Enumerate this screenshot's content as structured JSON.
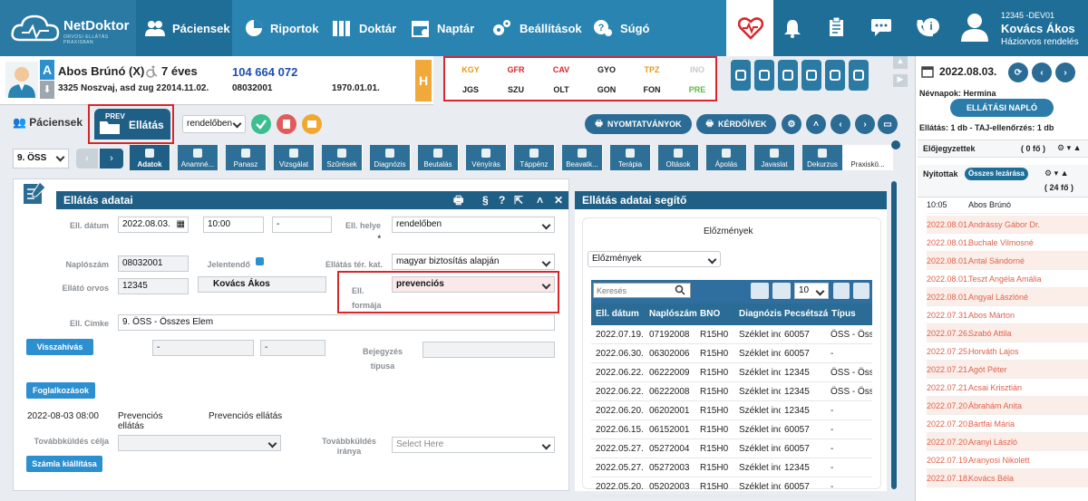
{
  "app": {
    "name": "NetDoktor",
    "tagline": "ORVOSI ELLÁTÁS PRAXISBAN"
  },
  "nav": {
    "items": [
      {
        "label": "Páciensek",
        "icon": "users-icon"
      },
      {
        "label": "Riportok",
        "icon": "pie-chart-icon"
      },
      {
        "label": "Doktár",
        "icon": "books-icon"
      },
      {
        "label": "Naptár",
        "icon": "calendar-icon"
      },
      {
        "label": "Beállítások",
        "icon": "gears-icon"
      },
      {
        "label": "Súgó",
        "icon": "help-icon"
      }
    ]
  },
  "user": {
    "id": "12345 -DEV01",
    "name": "Kovács Ákos",
    "role": "Háziorvos rendelés"
  },
  "patient": {
    "badge": "A",
    "name": "Abos Brúnó (X)",
    "age": "7 éves",
    "taj": "104 664 072",
    "address": "3325 Noszvaj, asd zug 2",
    "date1": "2014.11.02.",
    "code": "08032001",
    "birth": "1970.01.01.",
    "h_badge": "H"
  },
  "codes": [
    {
      "label": "KGY",
      "color": "#e39a17"
    },
    {
      "label": "GFR",
      "color": "#d9262c"
    },
    {
      "label": "CAV",
      "color": "#d9262c"
    },
    {
      "label": "GYO",
      "color": "#222222"
    },
    {
      "label": "TPZ",
      "color": "#e39a17"
    },
    {
      "label": "INO",
      "color": "#c9c9c9"
    },
    {
      "label": "JGS",
      "color": "#222222"
    },
    {
      "label": "SZU",
      "color": "#222222"
    },
    {
      "label": "OLT",
      "color": "#222222"
    },
    {
      "label": "GON",
      "color": "#222222"
    },
    {
      "label": "FON",
      "color": "#222222"
    },
    {
      "label": "PRE",
      "color": "#5fb83d"
    }
  ],
  "right": {
    "date": "2022.08.03.",
    "nevnapok": "Névnapok: Hermina",
    "naplo_btn": "ELLÁTÁSI NAPLÓ",
    "ellatas_info": "Ellátás: 1 db - TAJ-ellenőrzés: 1 db",
    "elojegyzettek": "Előjegyzettek",
    "elo_count": "( 0 fő )",
    "nyitottak": "Nyitottak",
    "osszes_lezarasa": "Összes lezárása",
    "ny_count": "( 24 fő )",
    "first": {
      "time": "10:05",
      "name": "Abos Brúnó"
    },
    "rows": [
      {
        "date": "2022.08.01.",
        "name": "Andrássy Gábor Dr."
      },
      {
        "date": "2022.08.01.",
        "name": "Buchale Vilmosné"
      },
      {
        "date": "2022.08.01.",
        "name": "Antal Sándorné"
      },
      {
        "date": "2022.08.01.",
        "name": "Teszt Angéla Amália"
      },
      {
        "date": "2022.08.01.",
        "name": "Angyal Lászlóné"
      },
      {
        "date": "2022.07.31.",
        "name": "Abos Márton"
      },
      {
        "date": "2022.07.26.",
        "name": "Szabó Attila"
      },
      {
        "date": "2022.07.25.",
        "name": "Horváth Lajos"
      },
      {
        "date": "2022.07.21.",
        "name": "Agót Péter"
      },
      {
        "date": "2022.07.21.",
        "name": "Acsai Krisztián"
      },
      {
        "date": "2022.07.20.",
        "name": "Ábrahám Anita"
      },
      {
        "date": "2022.07.20.",
        "name": "Bártfai Mária"
      },
      {
        "date": "2022.07.20.",
        "name": "Aranyi László"
      },
      {
        "date": "2022.07.19.",
        "name": "Aranyosi Nikolett"
      },
      {
        "date": "2022.07.18.",
        "name": "Kovács Béla"
      }
    ]
  },
  "tabs": {
    "paciensek": "Páciensek",
    "prev": "PREV",
    "ellatas": "Ellátás",
    "rendeloben": "rendelőben",
    "nyomtatvanyok": "NYOMTATVÁNYOK",
    "kerdoivek": "KÉRDŐÍVEK"
  },
  "toolbar": {
    "oss_select": "9. ÖSS",
    "tabs": [
      "Adatok",
      "Anamné...",
      "Panasz",
      "Vizsgálat",
      "Szűrések",
      "Diagnózis",
      "Beutalás",
      "Vényírás",
      "Táppénz",
      "Beavatk...",
      "Terápia",
      "Oltások",
      "Ápolás",
      "Javaslat",
      "Dekurzus",
      "Praxiskö..."
    ]
  },
  "form": {
    "title": "Ellátás adatai",
    "ell_datum_label": "Ell. dátum",
    "ell_datum": "2022.08.03.",
    "time": "10:00",
    "dash": "-",
    "ell_helye_label": "Ell. helye",
    "ell_helye": "rendelőben",
    "star": "*",
    "naploszam_label": "Naplószám",
    "naploszam": "08032001",
    "jelentendo_label": "Jelentendő",
    "ter_kat_label": "Ellátás tér. kat.",
    "ter_kat": "magyar biztosítás alapján",
    "orvos_label": "Ellátó orvos",
    "orvos_code": "12345",
    "orvos_name": "Kovács Ákos",
    "forma_label": "Ell. formája",
    "forma": "prevenciós",
    "cimke_label": "Ell. Címke",
    "cimke": "9. ÖSS - Összes Elem",
    "visszahivas": "Visszahívás",
    "bejegyzes_label": "Bejegyzés típusa",
    "foglalkozasok": "Foglalkozások",
    "hist_date": "2022-08-03 08:00",
    "hist_type": "Prevenciós ellátás",
    "hist_desc": "Prevenciós ellátás",
    "tovabb_celja": "Továbbküldés célja",
    "tovabb_iranya": "Továbbküldés iránya",
    "select_here": "Select Here",
    "szamla": "Számla kiállítása"
  },
  "helper": {
    "title": "Ellátás adatai segítő",
    "elozmenyek_title": "Előzmények",
    "elozmenyek_select": "Előzmények",
    "search_placeholder": "Keresés",
    "page_size": "10",
    "headers": [
      "Ell. dátum",
      "Naplószám",
      "BNO",
      "Diagnózis",
      "Pecsétszám",
      "Típus"
    ],
    "rows": [
      [
        "2022.07.19.",
        "07192008",
        "R15H0",
        "Széklet inc",
        "60057",
        "ÖSS - Össze"
      ],
      [
        "2022.06.30.",
        "06302006",
        "R15H0",
        "Széklet inc",
        "60057",
        "-"
      ],
      [
        "2022.06.22.",
        "06222009",
        "R15H0",
        "Széklet inc",
        "12345",
        "ÖSS - Össze"
      ],
      [
        "2022.06.22.",
        "06222008",
        "R15H0",
        "Széklet inc",
        "12345",
        "ÖSS - Össze"
      ],
      [
        "2022.06.20.",
        "06202001",
        "R15H0",
        "Széklet inc",
        "12345",
        "-"
      ],
      [
        "2022.06.15.",
        "06152001",
        "R15H0",
        "Széklet inc",
        "60057",
        "-"
      ],
      [
        "2022.05.27.",
        "05272004",
        "R15H0",
        "Széklet inc",
        "60057",
        "-"
      ],
      [
        "2022.05.27.",
        "05272003",
        "R15H0",
        "Széklet inc",
        "12345",
        "-"
      ],
      [
        "2022.05.20.",
        "05202003",
        "R15H0",
        "Széklet inc",
        "60057",
        "-"
      ]
    ]
  }
}
